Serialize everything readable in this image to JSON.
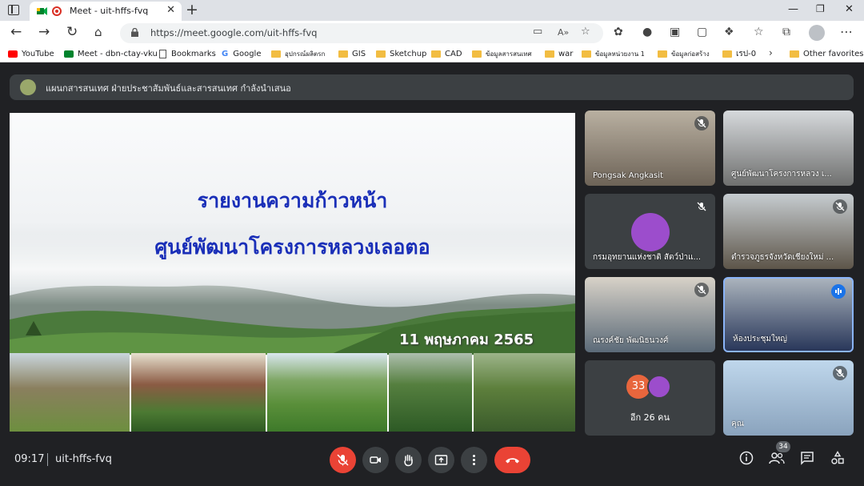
{
  "browser": {
    "tab_title": "Meet - uit-hffs-fvq",
    "url": "https://meet.google.com/uit-hffs-fvq",
    "bookmarks": [
      {
        "label": "YouTube",
        "icon": "youtube-icon"
      },
      {
        "label": "Meet - dbn-ctay-vku",
        "icon": "meet-icon"
      },
      {
        "label": "Bookmarks",
        "icon": "page-icon"
      },
      {
        "label": "Google",
        "icon": "google-icon"
      },
      {
        "label": "อุปกรณ์ผลิตรก",
        "icon": "folder-icon"
      },
      {
        "label": "GIS",
        "icon": "folder-icon"
      },
      {
        "label": "Sketchup",
        "icon": "folder-icon"
      },
      {
        "label": "CAD",
        "icon": "folder-icon"
      },
      {
        "label": "ข้อมูลสารสนเทศ",
        "icon": "folder-icon"
      },
      {
        "label": "war",
        "icon": "folder-icon"
      },
      {
        "label": "ข้อมูลหน่วยงาน 1",
        "icon": "folder-icon"
      },
      {
        "label": "ข้อมูลก่อสร้าง",
        "icon": "folder-icon"
      },
      {
        "label": "เรป-0",
        "icon": "folder-icon"
      }
    ],
    "other_favorites": "Other favorites"
  },
  "meeting": {
    "presenter_banner": "แผนกสารสนเทศ ฝ่ายประชาสัมพันธ์และสารสนเทศ กำลังนำเสนอ",
    "slide": {
      "title_line1": "รายงานความก้าวหน้า",
      "title_line2": "ศูนย์พัฒนาโครงการหลวงเลอตอ",
      "date": "11 พฤษภาคม 2565"
    },
    "participants": [
      {
        "name": "Pongsak Angkasit",
        "muted": true
      },
      {
        "name": "ศูนย์พัฒนาโครงการหลวง เ...",
        "muted": false
      },
      {
        "name": "กรมอุทยานแห่งชาติ สัตว์ป่าแ...",
        "muted": true
      },
      {
        "name": "ตำรวจภูธรจังหวัดเชียงใหม่ ...",
        "muted": true
      },
      {
        "name": "ณรงค์ชัย พัฒนิธนวงศ์",
        "muted": true
      },
      {
        "name": "ห้องประชุมใหญ่",
        "muted": false,
        "speaking": true
      },
      {
        "name": "อีก 26 คน",
        "muted": false,
        "badge": "33"
      },
      {
        "name": "คุณ",
        "muted": true
      }
    ],
    "time": "09:17",
    "code": "uit-hffs-fvq",
    "people_count": "34",
    "colors": {
      "end_call": "#ea4335",
      "mic_muted": "#ea4335",
      "speaking": "#1a73e8",
      "title_text": "#1a2fb8"
    }
  }
}
